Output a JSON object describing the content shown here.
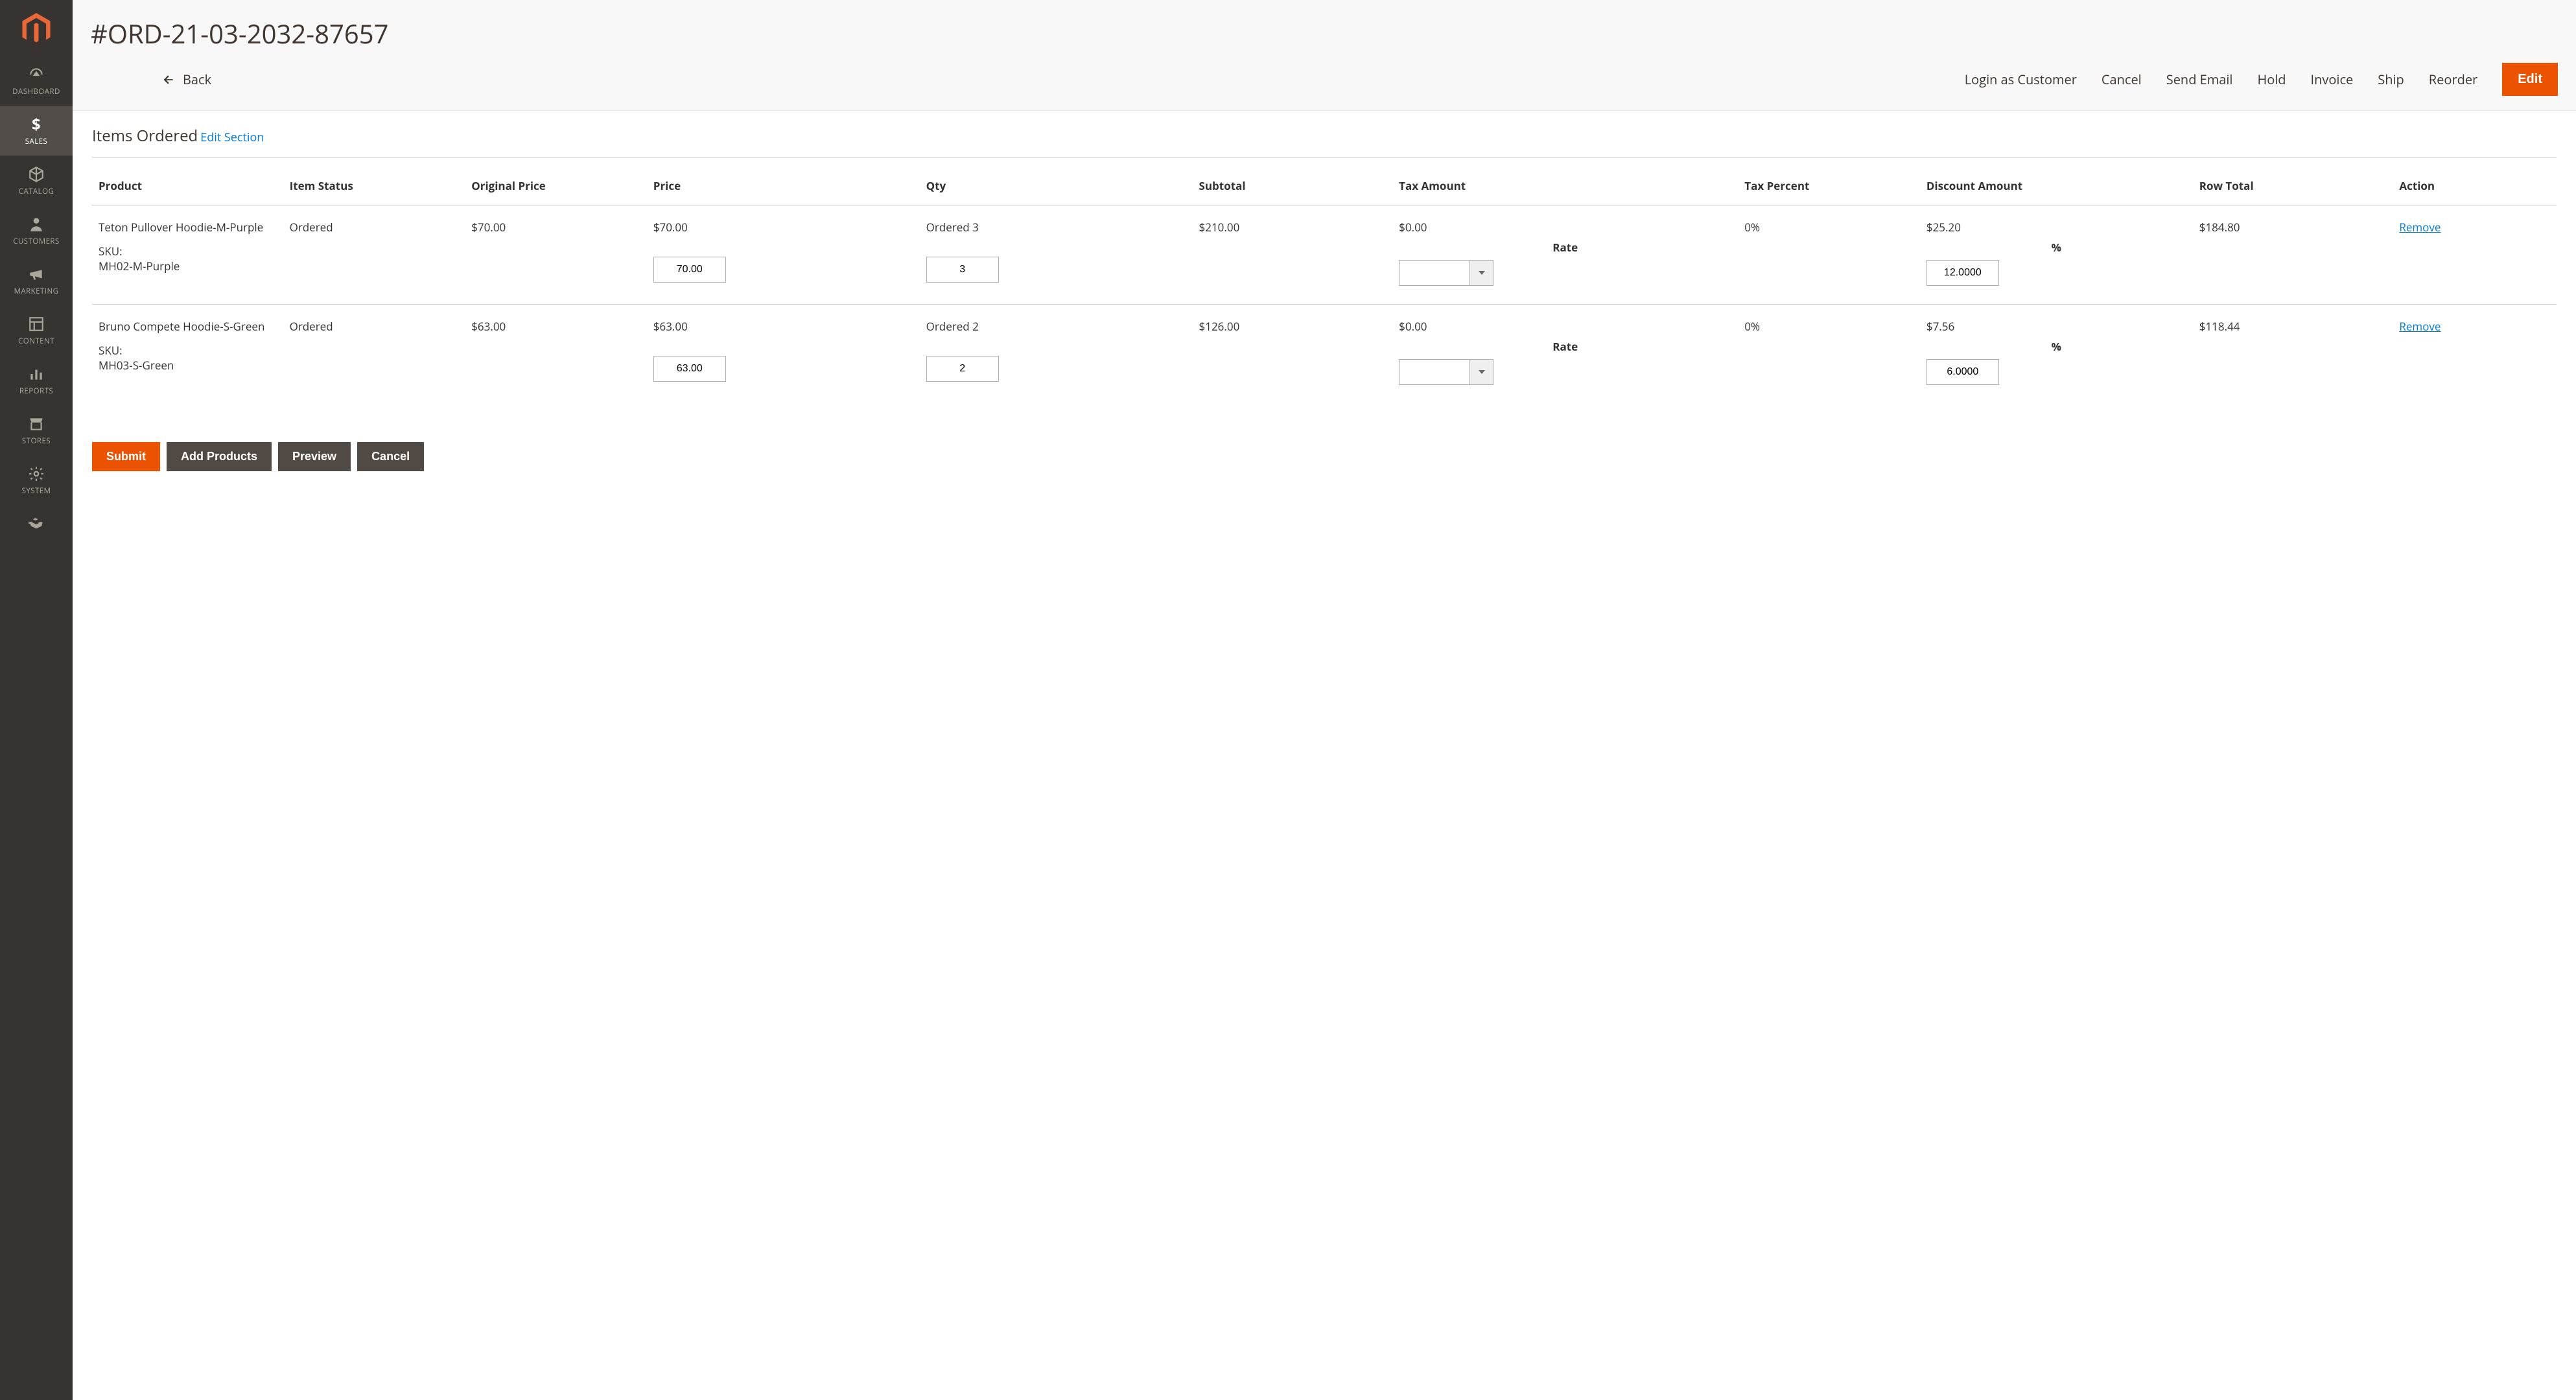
{
  "sidebar": {
    "items": [
      {
        "label": "DASHBOARD"
      },
      {
        "label": "SALES"
      },
      {
        "label": "CATALOG"
      },
      {
        "label": "CUSTOMERS"
      },
      {
        "label": "MARKETING"
      },
      {
        "label": "CONTENT"
      },
      {
        "label": "REPORTS"
      },
      {
        "label": "STORES"
      },
      {
        "label": "SYSTEM"
      }
    ]
  },
  "header": {
    "order_title": "#ORD-21-03-2032-87657",
    "back_label": "Back",
    "actions": {
      "login_as_customer": "Login as Customer",
      "cancel": "Cancel",
      "send_email": "Send Email",
      "hold": "Hold",
      "invoice": "Invoice",
      "ship": "Ship",
      "reorder": "Reorder",
      "edit": "Edit"
    }
  },
  "section": {
    "title": "Items Ordered",
    "edit_label": "Edit Section"
  },
  "table": {
    "headers": {
      "product": "Product",
      "item_status": "Item Status",
      "original_price": "Original Price",
      "price": "Price",
      "qty": "Qty",
      "subtotal": "Subtotal",
      "tax_amount": "Tax Amount",
      "tax_percent": "Tax Percent",
      "discount_amount": "Discount Amount",
      "row_total": "Row Total",
      "action": "Action"
    },
    "sub": {
      "rate": "Rate",
      "percent": "%",
      "sku_prefix": "SKU:",
      "remove": "Remove",
      "ordered_prefix": "Ordered"
    },
    "rows": [
      {
        "name": "Teton Pullover Hoodie-M-Purple",
        "sku": "MH02-M-Purple",
        "status": "Ordered",
        "original_price": "$70.00",
        "price_display": "$70.00",
        "price_input": "70.00",
        "qty_display": "Ordered 3",
        "qty_input": "3",
        "subtotal": "$210.00",
        "tax_amount": "$0.00",
        "tax_rate": "",
        "tax_percent": "0%",
        "discount_display": "$25.20",
        "discount_input": "12.0000",
        "row_total": "$184.80"
      },
      {
        "name": "Bruno Compete Hoodie-S-Green",
        "sku": "MH03-S-Green",
        "status": "Ordered",
        "original_price": "$63.00",
        "price_display": "$63.00",
        "price_input": "63.00",
        "qty_display": "Ordered 2",
        "qty_input": "2",
        "subtotal": "$126.00",
        "tax_amount": "$0.00",
        "tax_rate": "",
        "tax_percent": "0%",
        "discount_display": "$7.56",
        "discount_input": "6.0000",
        "row_total": "$118.44"
      }
    ]
  },
  "footer": {
    "submit": "Submit",
    "add_products": "Add Products",
    "preview": "Preview",
    "cancel": "Cancel"
  }
}
